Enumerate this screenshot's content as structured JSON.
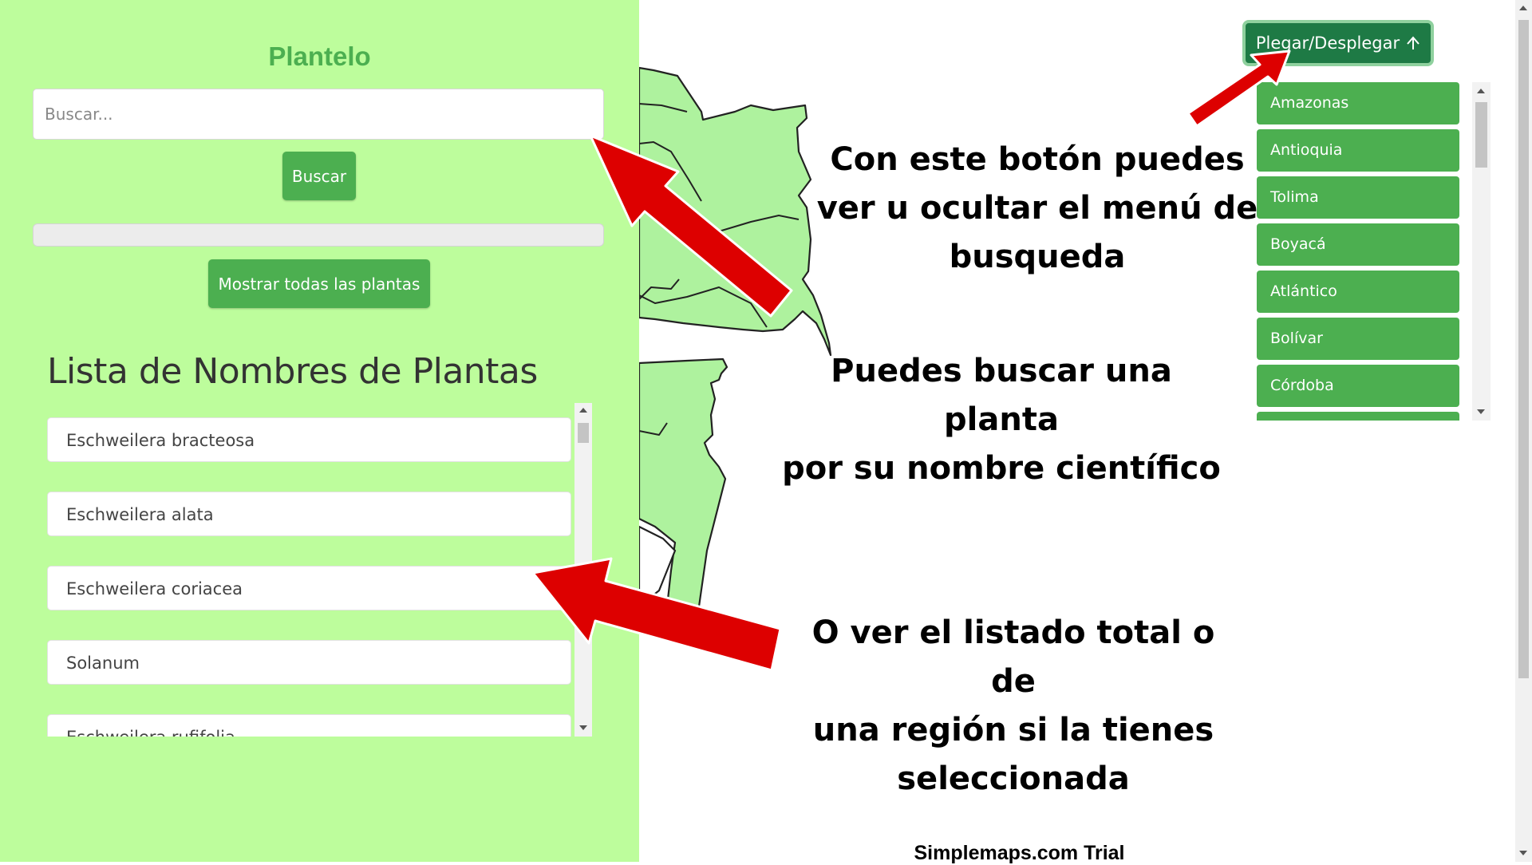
{
  "sidebar": {
    "title": "Plantelo",
    "search_placeholder": "Buscar...",
    "search_button": "Buscar",
    "show_all_button": "Mostrar todas las plantas",
    "list_heading": "Lista de Nombres de Plantas",
    "plants": [
      "Eschweilera bracteosa",
      "Eschweilera alata",
      "Eschweilera coriacea",
      "Solanum",
      "Eschweilera rufifolia"
    ]
  },
  "map_panel": {
    "toggle_button": "Plegar/Desplegar",
    "toggle_icon": "collapse-up-arrow",
    "regions": [
      "Amazonas",
      "Antioquia",
      "Tolima",
      "Boyacá",
      "Atlántico",
      "Bolívar",
      "Córdoba"
    ],
    "watermark": "Simplemaps.com Trial"
  },
  "annotations": {
    "toggle_note": [
      "Con este botón puedes",
      "ver u ocultar el menú de",
      "busqueda"
    ],
    "search_note": [
      "Puedes buscar una planta",
      "por su nombre científico"
    ],
    "list_note": [
      "O ver el listado total o de",
      "una región si la tienes",
      "seleccionada"
    ]
  },
  "colors": {
    "sidebar_bg": "#bdfd9c",
    "accent_green": "#4caf50",
    "toggle_green": "#1e7a45",
    "map_fill": "#aef29e",
    "arrow_red": "#dd0000"
  }
}
